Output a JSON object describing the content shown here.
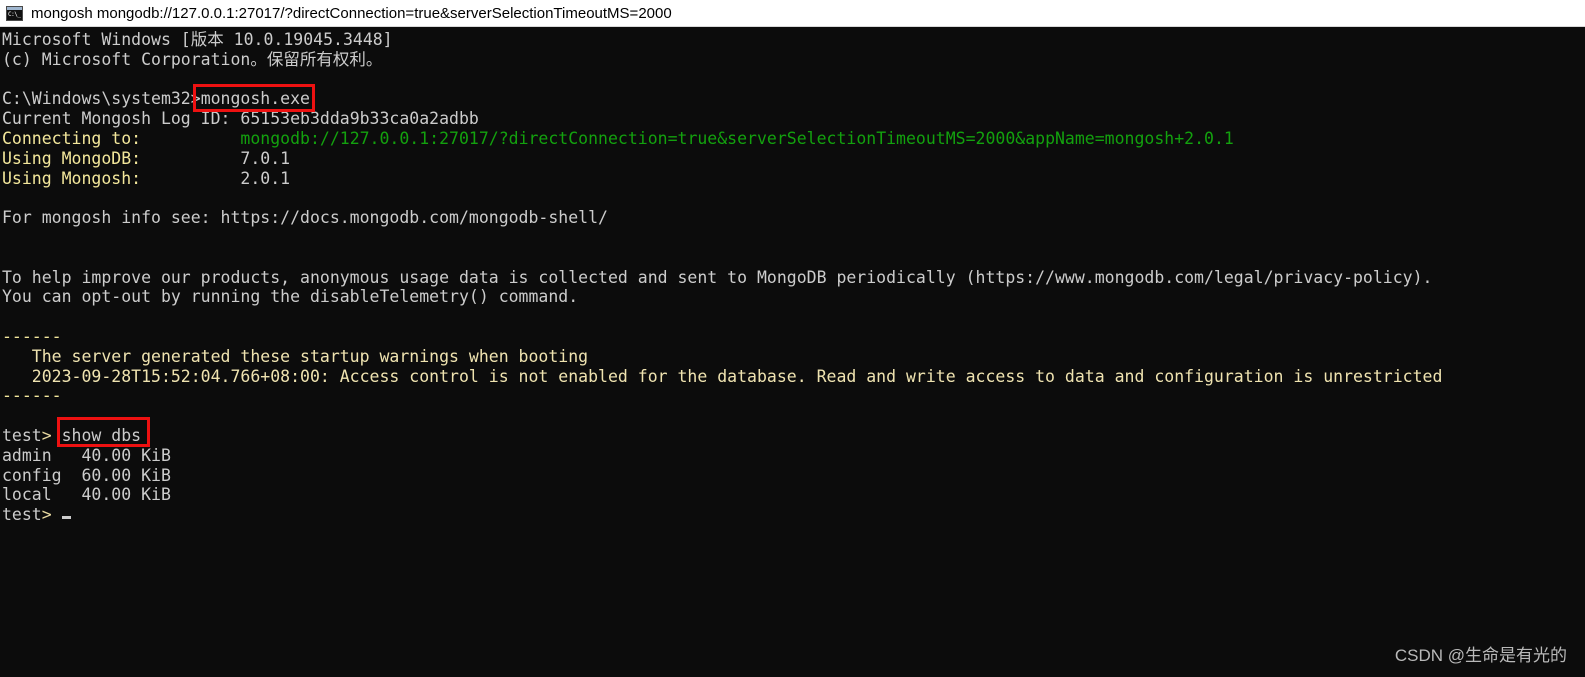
{
  "window": {
    "icon": "command-prompt-icon",
    "icon_glyph": "C:\\_",
    "title": "mongosh mongodb://127.0.0.1:27017/?directConnection=true&serverSelectionTimeoutMS=2000",
    "titlebar_bg": "#ffffff",
    "titlebar_fg": "#000000"
  },
  "terminal": {
    "background": "#0c0c0c",
    "default_fg": "#cccccc",
    "lines": [
      {
        "id": "win-version",
        "text": "Microsoft Windows [版本 10.0.19045.3448]",
        "color": "#cccccc"
      },
      {
        "id": "win-copyright",
        "text": "(c) Microsoft Corporation。保留所有权利。",
        "color": "#cccccc"
      },
      {
        "id": "blank-1",
        "text": "",
        "color": "#cccccc"
      },
      {
        "id": "prompt-cmd",
        "prompt": "C:\\Windows\\system32>",
        "command": "mongosh.exe",
        "color": "#cccccc"
      },
      {
        "id": "log-id",
        "label": "Current Mongosh Log ID:",
        "value": "65153eb3dda9b33ca0a2adbb",
        "color": "#cccccc"
      },
      {
        "id": "connecting-to",
        "label": "Connecting to:",
        "value": "mongodb://127.0.0.1:27017/?directConnection=true&serverSelectionTimeoutMS=2000&appName=mongosh+2.0.1",
        "label_color": "#f3e79b",
        "value_color": "#13a10e"
      },
      {
        "id": "using-mongodb",
        "label": "Using MongoDB:",
        "value": "7.0.1",
        "label_color": "#f3e79b",
        "value_color": "#cccccc"
      },
      {
        "id": "using-mongosh",
        "label": "Using Mongosh:",
        "value": "2.0.1",
        "label_color": "#f3e79b",
        "value_color": "#cccccc"
      },
      {
        "id": "blank-2",
        "text": "",
        "color": "#cccccc"
      },
      {
        "id": "docs-link",
        "text": "For mongosh info see: https://docs.mongodb.com/mongodb-shell/",
        "color": "#cccccc"
      },
      {
        "id": "blank-3",
        "text": "",
        "color": "#cccccc"
      },
      {
        "id": "blank-4",
        "text": "",
        "color": "#cccccc"
      },
      {
        "id": "telemetry-1",
        "text": "To help improve our products, anonymous usage data is collected and sent to MongoDB periodically (https://www.mongodb.com/legal/privacy-policy).",
        "color": "#cccccc"
      },
      {
        "id": "telemetry-2",
        "text": "You can opt-out by running the disableTelemetry() command.",
        "color": "#cccccc"
      },
      {
        "id": "blank-5",
        "text": "",
        "color": "#cccccc"
      },
      {
        "id": "rule-top",
        "text": "------",
        "color": "#f3e79b"
      },
      {
        "id": "warn-heading",
        "text": "   The server generated these startup warnings when booting",
        "color": "#efe3b0"
      },
      {
        "id": "warn-body",
        "text": "   2023-09-28T15:52:04.766+08:00: Access control is not enabled for the database. Read and write access to data and configuration is unrestricted",
        "color": "#efe3b0"
      },
      {
        "id": "rule-bottom",
        "text": "------",
        "color": "#f3e79b"
      },
      {
        "id": "blank-6",
        "text": "",
        "color": "#cccccc"
      }
    ],
    "show_dbs_prompt": {
      "prompt_db": "test",
      "prompt_chevron": ">",
      "command": "show dbs",
      "prompt_color": "#cccccc",
      "chevron_color": "#e8d9a0"
    },
    "databases": {
      "rows": [
        {
          "name": "admin",
          "size": "40.00 KiB"
        },
        {
          "name": "config",
          "size": "60.00 KiB"
        },
        {
          "name": "local",
          "size": "40.00 KiB"
        }
      ]
    },
    "final_prompt": {
      "prompt_db": "test",
      "prompt_chevron": ">",
      "cursor": "block-cursor"
    }
  },
  "annotations": {
    "color": "#ee1111",
    "boxes": [
      {
        "id": "redbox-mongosh",
        "target": "mongosh.exe"
      },
      {
        "id": "redbox-showdbs",
        "target": "show dbs"
      }
    ]
  },
  "watermark": {
    "text": "CSDN @生命是有光的",
    "color": "#b9b9b9"
  }
}
